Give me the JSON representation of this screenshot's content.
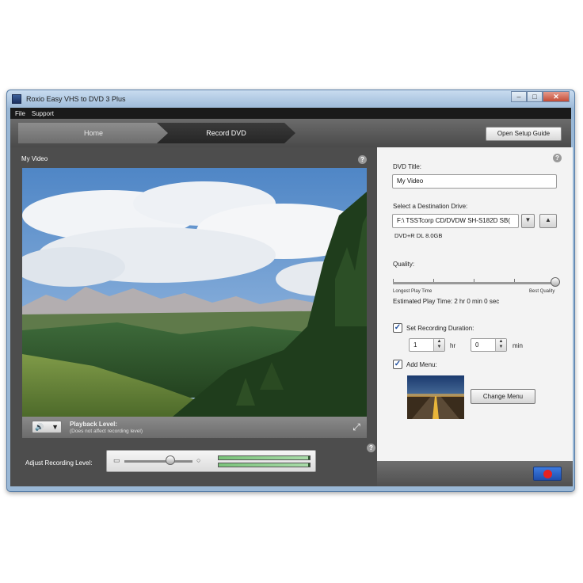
{
  "window": {
    "title": "Roxio Easy VHS to DVD 3 Plus",
    "minimize_glyph": "–",
    "maximize_glyph": "□",
    "close_glyph": "✕"
  },
  "menubar": {
    "items": [
      "File",
      "Support"
    ]
  },
  "nav": {
    "home_label": "Home",
    "record_label": "Record DVD",
    "setup_guide_label": "Open Setup Guide"
  },
  "video": {
    "title": "My Video",
    "help_glyph": "?",
    "playback_level_label": "Playback Level:",
    "playback_level_note": "(Does not affect recording level)",
    "volume_glyph": "🔊",
    "volume_dropdown_glyph": "▼",
    "fullscreen_glyph": "⤢"
  },
  "recording_level": {
    "label": "Adjust Recording Level:",
    "slider_value": 0.67,
    "minus_glyph": "▭",
    "plus_glyph": "○",
    "meter_left": 0.98,
    "meter_right": 0.98
  },
  "settings": {
    "dvd_title_label": "DVD Title:",
    "dvd_title_value": "My Video",
    "drive_label": "Select a Destination Drive:",
    "drive_value": "F:\\ TSSTcorp CD/DVDW SH-S182D SB(",
    "drive_dropdown_glyph": "▼",
    "eject_glyph": "▲",
    "disc_info": "DVD+R DL 8.0GB",
    "quality_label": "Quality:",
    "quality_value": 1.0,
    "quality_min_label": "Longest Play Time",
    "quality_max_label": "Best Quality",
    "estimated_time": "Estimated Play Time: 2 hr 0 min 0 sec",
    "set_duration_label": "Set Recording Duration:",
    "set_duration_checked": true,
    "check_glyph": "✓",
    "hours_value": "1",
    "hours_unit": "hr",
    "minutes_value": "0",
    "minutes_unit": "min",
    "spin_up_glyph": "▲",
    "spin_down_glyph": "▼",
    "add_menu_label": "Add Menu:",
    "add_menu_checked": true,
    "change_menu_label": "Change Menu"
  },
  "colors": {
    "record_button": "#2a5fc7",
    "record_dot": "#e52222",
    "left_pane": "#4d4d4d"
  }
}
